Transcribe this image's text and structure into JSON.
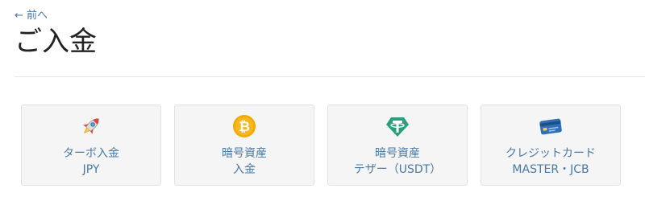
{
  "nav": {
    "back_label": "← 前へ"
  },
  "page": {
    "title": "ご入金"
  },
  "cards": [
    {
      "line1": "ターボ入金",
      "line2": "JPY",
      "icon": "rocket-icon"
    },
    {
      "line1": "暗号資産",
      "line2": "入金",
      "icon": "bitcoin-icon"
    },
    {
      "line1": "暗号資産",
      "line2": "テザー（USDT）",
      "icon": "tether-icon"
    },
    {
      "line1": "クレジットカード",
      "line2": "MASTER・JCB",
      "icon": "credit-card-icon"
    }
  ],
  "colors": {
    "link": "#4a78a0",
    "card_bg": "#f5f5f5",
    "bitcoin": "#f2a900",
    "tether": "#26a17b",
    "card_blue": "#2f6fb5"
  }
}
